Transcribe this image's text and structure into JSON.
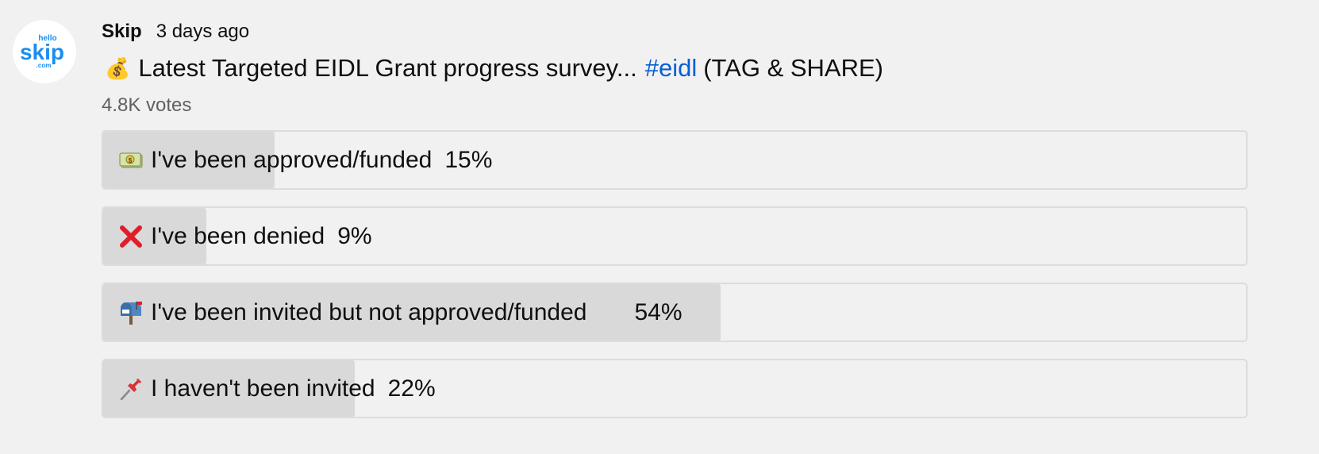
{
  "channel": {
    "avatar_text_top": "hello",
    "avatar_text_main": "skip",
    "avatar_text_bottom": ".com",
    "avatar_color": "#1a8df0"
  },
  "post": {
    "author": "Skip",
    "time": "3 days ago",
    "emoji": "💰",
    "text_before": "Latest Targeted EIDL Grant progress survey...",
    "hashtag": "#eidl",
    "text_after": "(TAG & SHARE)",
    "votes": "4.8K votes"
  },
  "poll": {
    "options": [
      {
        "icon": "money-bill-icon",
        "label": "I've been approved/funded",
        "percent_label": "15%",
        "percent": 15
      },
      {
        "icon": "red-x-icon",
        "label": "I've been denied",
        "percent_label": "9%",
        "percent": 9
      },
      {
        "icon": "mailbox-icon",
        "label": "I've been invited but not approved/funded",
        "percent_label": "54%",
        "percent": 54
      },
      {
        "icon": "pushpin-icon",
        "label": "I haven't been invited",
        "percent_label": "22%",
        "percent": 22
      }
    ]
  },
  "colors": {
    "background": "#f1f1f1",
    "fill": "#d9d9d9",
    "hashtag": "#065fd4"
  }
}
